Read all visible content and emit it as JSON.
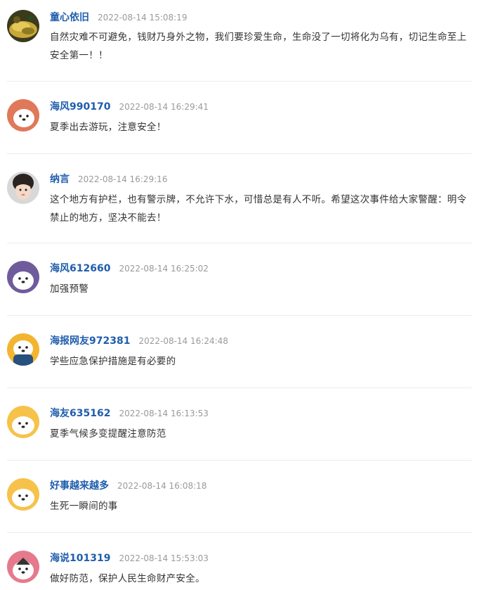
{
  "comments": [
    {
      "user": "童心依旧",
      "time": "2022-08-14 15:08:19",
      "text": "自然灾难不可避免，钱财乃身外之物，我们要珍爱生命，生命没了一切将化为乌有，切记生命至上安全第一！！",
      "avatar": "photo-food"
    },
    {
      "user": "海风990170",
      "time": "2022-08-14 16:29:41",
      "text": "夏季出去游玩，注意安全！",
      "avatar": "seal-orange"
    },
    {
      "user": "纳言",
      "time": "2022-08-14 16:29:16",
      "text": "这个地方有护栏，也有警示牌，不允许下水，可惜总是有人不听。希望这次事件给大家警醒：明令禁止的地方，坚决不能去！",
      "avatar": "photo-child"
    },
    {
      "user": "海风612660",
      "time": "2022-08-14 16:25:02",
      "text": "加强预警",
      "avatar": "seal-purple"
    },
    {
      "user": "海报网友972381",
      "time": "2022-08-14 16:24:48",
      "text": "学些应急保护措施是有必要的",
      "avatar": "seal-yellow-blue"
    },
    {
      "user": "海友635162",
      "time": "2022-08-14 16:13:53",
      "text": "夏季气候多变提醒注意防范",
      "avatar": "seal-yellow"
    },
    {
      "user": "好事越来越多",
      "time": "2022-08-14 16:08:18",
      "text": "生死一瞬间的事",
      "avatar": "seal-yellow"
    },
    {
      "user": "海说101319",
      "time": "2022-08-14 15:53:03",
      "text": "做好防范，保护人民生命财产安全。",
      "avatar": "seal-pink"
    }
  ]
}
